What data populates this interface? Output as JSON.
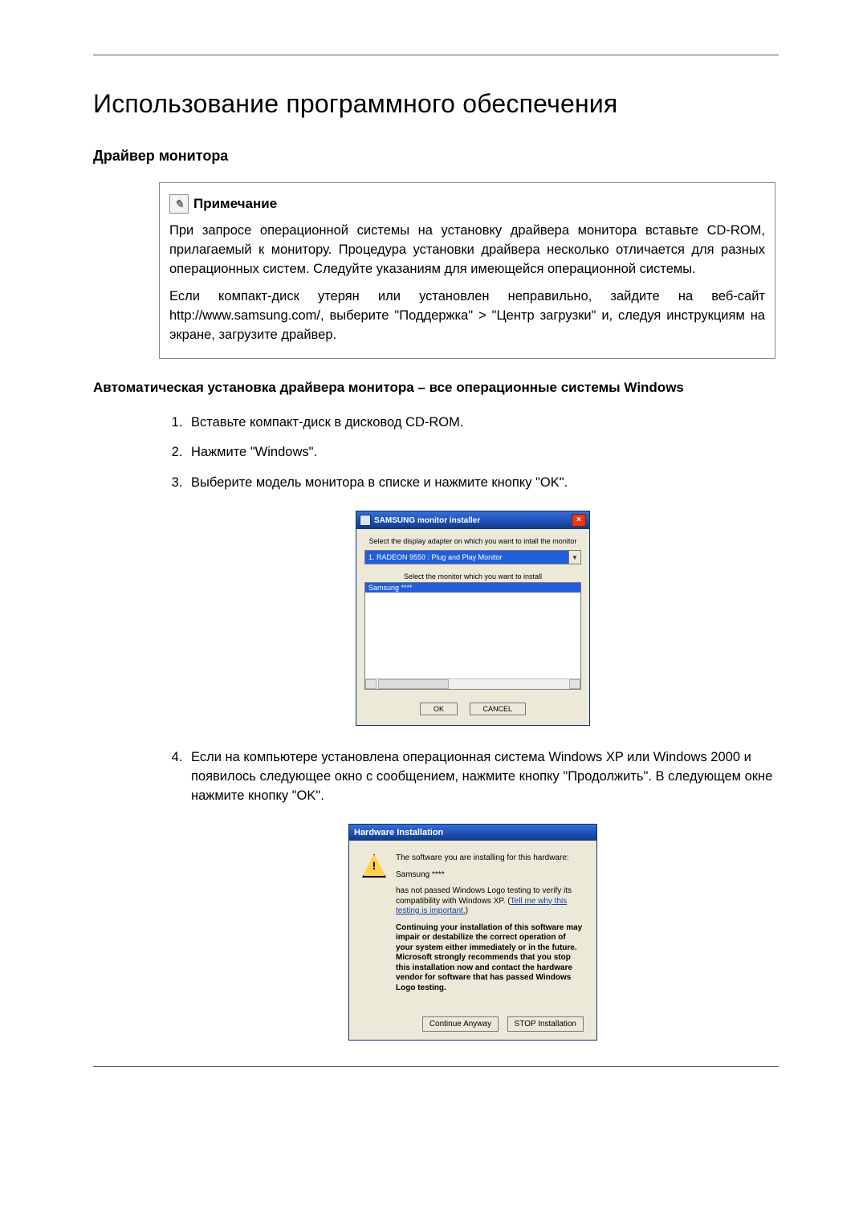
{
  "heading_main": "Использование программного обеспечения",
  "heading_section": "Драйвер монитора",
  "note": {
    "title": "Примечание",
    "p1": "При запросе операционной системы на установку драйвера монитора вставьте CD-ROM, прилагаемый к монитору. Процедура установки драйвера несколько отличается для разных операционных систем. Следуйте указаниям для имеющейся операционной системы.",
    "p2": "Если компакт-диск утерян или установлен неправильно, зайдите на веб-сайт http://www.samsung.com/, выберите \"Поддержка\" > \"Центр загрузки\" и, следуя инструкциям на экране, загрузите драйвер."
  },
  "heading_auto": "Автоматическая установка драйвера монитора – все операционные системы Windows",
  "steps": {
    "s1": "Вставьте компакт-диск в дисковод CD-ROM.",
    "s2": "Нажмите \"Windows\".",
    "s3": "Выберите модель монитора в списке и нажмите кнопку \"OK\".",
    "s4": "Если на компьютере установлена операционная система Windows XP или Windows 2000 и появилось следующее окно с сообщением, нажмите кнопку \"Продолжить\". В следующем окне нажмите кнопку \"OK\"."
  },
  "dlg1": {
    "title": "SAMSUNG monitor installer",
    "label_adapter": "Select the display adapter on which you want to intall the monitor",
    "adapter_value": "1. RADEON 9550 : Plug and Play Monitor",
    "label_monitor": "Select the monitor which you want to install",
    "monitor_selected": "Samsung ****",
    "btn_ok": "OK",
    "btn_cancel": "CANCEL",
    "close_glyph": "×"
  },
  "dlg2": {
    "title": "Hardware Installation",
    "line1": "The software you are installing for this hardware:",
    "line2": "Samsung ****",
    "line3a": "has not passed Windows Logo testing to verify its compatibility with Windows XP. (",
    "link": "Tell me why this testing is important.",
    "line3b": ")",
    "bold": "Continuing your installation of this software may impair or destabilize the correct operation of your system either immediately or in the future. Microsoft strongly recommends that you stop this installation now and contact the hardware vendor for software that has passed Windows Logo testing.",
    "btn_continue": "Continue Anyway",
    "btn_stop": "STOP Installation",
    "warn_glyph": "!"
  }
}
